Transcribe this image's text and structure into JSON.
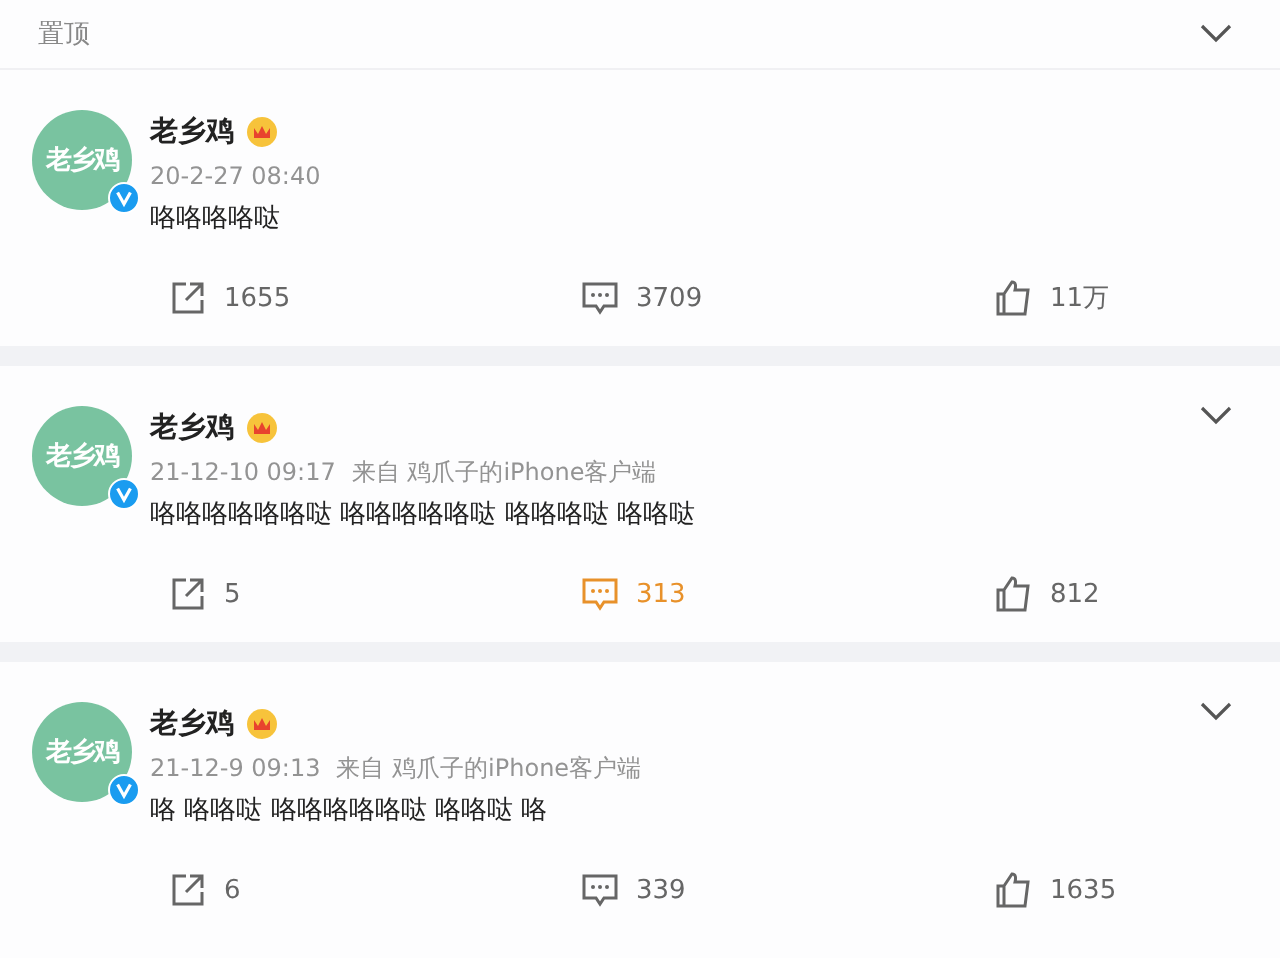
{
  "pinned_header": {
    "label": "置顶"
  },
  "posts": [
    {
      "pinned": true,
      "avatar_text": "老乡鸡",
      "author": "老乡鸡",
      "verified": true,
      "time": "20-2-27 08:40",
      "text": "咯咯咯咯哒",
      "actions": [
        {
          "kind": "share",
          "count": "1655",
          "highlighted": false
        },
        {
          "kind": "comment",
          "count": "3709",
          "highlighted": false
        },
        {
          "kind": "like",
          "count": "11万",
          "highlighted": false
        }
      ]
    },
    {
      "pinned": false,
      "avatar_text": "老乡鸡",
      "author": "老乡鸡",
      "verified": true,
      "time": "21-12-10 09:17",
      "source": "来自 鸡爪子的iPhone客户端",
      "text": "咯咯咯咯咯咯哒 咯咯咯咯咯哒 咯咯咯哒 咯咯哒",
      "actions": [
        {
          "kind": "share",
          "count": "5",
          "highlighted": false
        },
        {
          "kind": "comment",
          "count": "313",
          "highlighted": true
        },
        {
          "kind": "like",
          "count": "812",
          "highlighted": false
        }
      ]
    },
    {
      "pinned": false,
      "avatar_text": "老乡鸡",
      "author": "老乡鸡",
      "verified": true,
      "time": "21-12-9 09:13",
      "source": "来自 鸡爪子的iPhone客户端",
      "text": "咯 咯咯哒 咯咯咯咯咯哒 咯咯哒 咯",
      "actions": [
        {
          "kind": "share",
          "count": "6",
          "highlighted": false
        },
        {
          "kind": "comment",
          "count": "339",
          "highlighted": false
        },
        {
          "kind": "like",
          "count": "1635",
          "highlighted": false
        }
      ]
    }
  ]
}
